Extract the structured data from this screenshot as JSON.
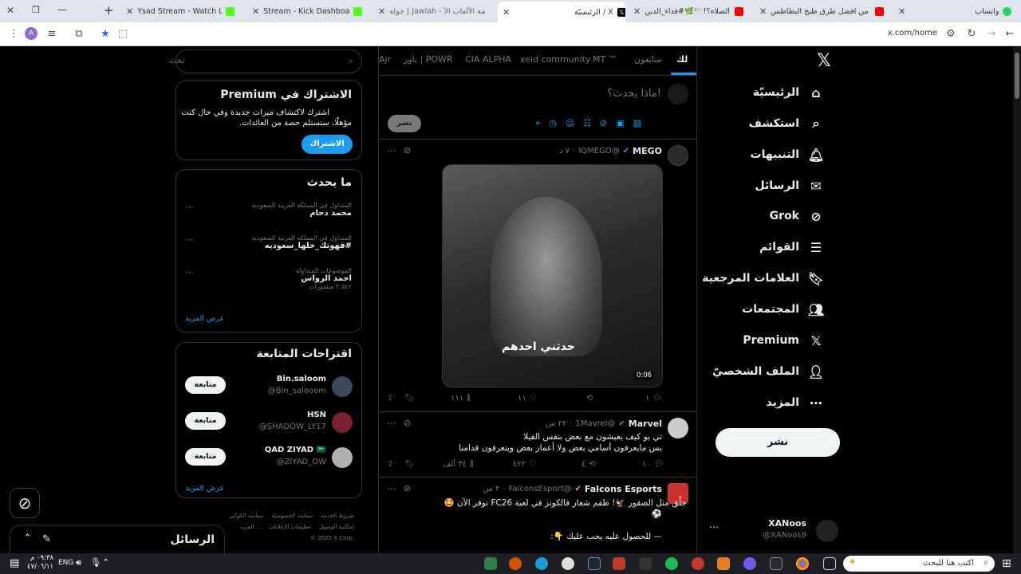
{
  "tabs": [
    {
      "title": "واتساب",
      "color": "#25d366"
    },
    {
      "title": "من افضل طرق طبخ البطاطس",
      "color": "#ff0000"
    },
    {
      "title": "تأخير الصلاة؟!🕊️🌿#فداء_الدين",
      "color": "#ff0000"
    },
    {
      "title": "الرئيسيّة / X",
      "color": "#000000"
    },
    {
      "title": "جولة | Jawlah - منصة الألعاب الأ",
      "color": "#e84c3d"
    },
    {
      "title": "Stream - Kick Dashboard",
      "color": "#53fc18"
    },
    {
      "title": "Ysad Stream - Watch Live on Kic",
      "color": "#53fc18"
    }
  ],
  "browser": {
    "url": "x.com/home",
    "new_tab_symbol": "+",
    "profile_initial": "A"
  },
  "nav": {
    "items": [
      {
        "label": "الرئيسيّة",
        "icon": "home-icon"
      },
      {
        "label": "استكشف",
        "icon": "search-icon"
      },
      {
        "label": "التنبيهات",
        "icon": "bell-icon"
      },
      {
        "label": "الرسائل",
        "icon": "mail-icon"
      },
      {
        "label": "Grok",
        "icon": "grok-icon"
      },
      {
        "label": "القوائم",
        "icon": "list-icon"
      },
      {
        "label": "العلامات المرجعية",
        "icon": "bookmark-icon"
      },
      {
        "label": "المجتمعات",
        "icon": "communities-icon"
      },
      {
        "label": "Premium",
        "icon": "x-icon"
      },
      {
        "label": "الملف الشخصيّ",
        "icon": "profile-icon"
      },
      {
        "label": "المزيد",
        "icon": "more-icon"
      }
    ],
    "post_label": "نشر",
    "account": {
      "name": "XANoos",
      "handle": "@XANoos9"
    }
  },
  "feed": {
    "tabs": [
      "لك",
      "متابَعون",
      "MT ™",
      "xeid community",
      "CIA ALPHA",
      "باور | POWR",
      "Ajr"
    ],
    "compose_placeholder": "ماذا يحدث؟!",
    "compose_button": "نشر",
    "tweets": [
      {
        "name": "MEGO",
        "handle": "@IQMEGO",
        "time": "٧ د",
        "media_caption": "حدثني احدهم",
        "duration": "0:06",
        "replies": "١",
        "retweets": "",
        "likes": "١١",
        "views": "١١١"
      },
      {
        "name": "Marvel",
        "handle": "@1Mavrel",
        "time": "٢٢ س",
        "line1": "تي يو كيف يعيشون مع بعض بنفس الفيلا",
        "line2": "بس مايعرفون أسامي بعض ولا أعمار بعض ويتعرفون قدامنا",
        "replies": "١٠",
        "retweets": "٤",
        "likes": "٤٢٢",
        "views": "٣٤ ألف"
      },
      {
        "name": "Falcons Esports",
        "handle": "@FalconsEsport",
        "time": "٢ س",
        "line1": "حلّق مثل الصقور 🦅! طقم شعار فالكونز في لعبة FC26 توفر الآن 🤩",
        "line2": "⚽",
        "line3": "— للحصول عليه يجب عليك 👇:"
      }
    ]
  },
  "sidebar": {
    "search_placeholder": "بحث",
    "premium": {
      "title": "الاشتراك في Premium",
      "body1": "اشترك لاكتشاف ميزات جديدة وفي حال كنت",
      "body2": "مؤهلًا، ستستلم حصة من العائدات.",
      "button": "الاشتراك"
    },
    "trends": {
      "title": "ما يحدث",
      "items": [
        {
          "context": "المتداول في المملكة العربية السعودية",
          "name": "محمد دحام",
          "count": ""
        },
        {
          "context": "المتداول في المملكة العربية السعودية",
          "name": "#قهوتك_خلها_سعوديه",
          "count": ""
        },
        {
          "context": "الموضوعات المتداولة",
          "name": "احمد الرواس",
          "count": "٢,٥٤٢ منشورات"
        }
      ],
      "more": "عرض المزيد"
    },
    "follow": {
      "title": "اقتراحات المتابعة",
      "items": [
        {
          "name": "Bin.saloom",
          "handle": "@Bin_salooom",
          "button": "متابعة"
        },
        {
          "name": "HSN",
          "handle": "@SHADOW_LY17",
          "button": "متابعة"
        },
        {
          "name": "QAD ZIYAD 🇸🇦",
          "handle": "@ZIYAD_OW",
          "button": "متابعة"
        }
      ],
      "more": "عرض المزيد"
    },
    "footer": {
      "row1": [
        "شروط الخدمة",
        "سياسة الخصوصيّة",
        "سياسة الكوكيز"
      ],
      "row2": [
        "إمكانية الوصول",
        "معلومات الإعلانات",
        "... المزيد"
      ],
      "copyright": "© 2025 X Corp."
    },
    "messages_label": "الرسائل"
  },
  "taskbar": {
    "search_placeholder": "اكتب هنا للبحث",
    "lang": "ENG",
    "time": "٠٩:٣٨ م",
    "date": "٤٧/٠٦/١١"
  },
  "colors": {
    "accent": "#1d9bf0",
    "bg": "#000000",
    "border": "#2f3336",
    "muted": "#71767b"
  }
}
